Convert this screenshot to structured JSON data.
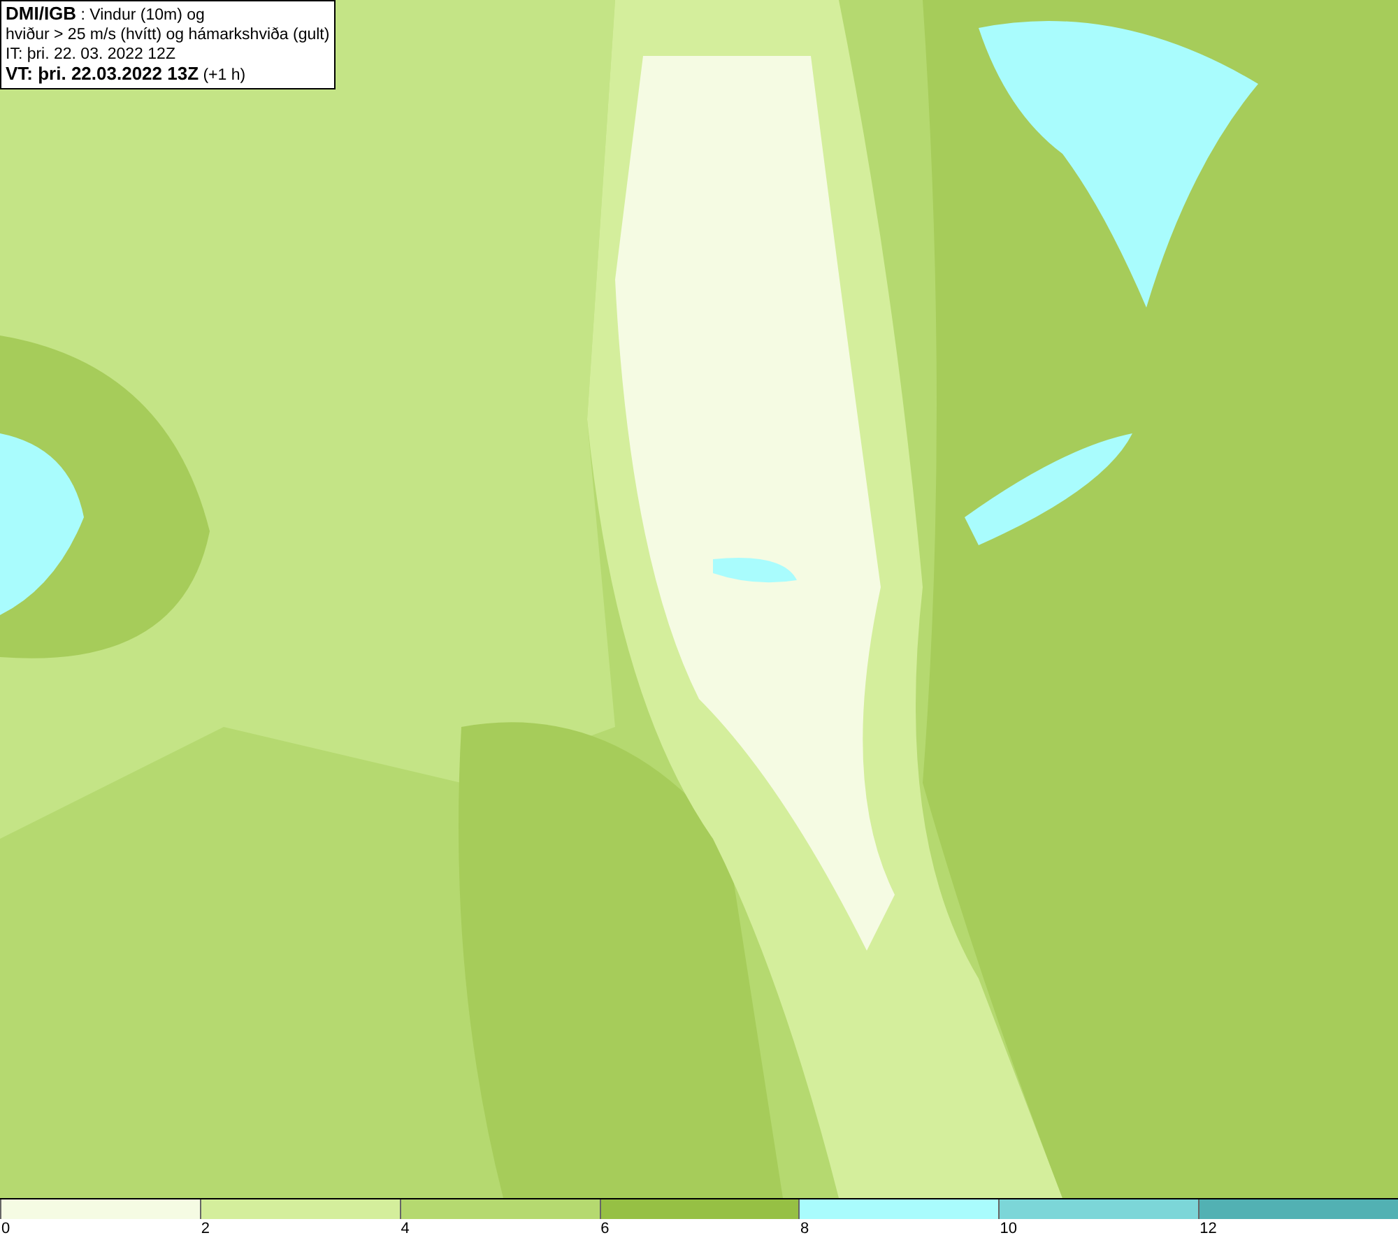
{
  "caption": [
    "**DMI/IGB** : Vindur (10m) og",
    "hviður > 25 m/s (hvítt) og hámarkshviða (gult)",
    "IT: þri. 22. 03. 2022 12Z",
    "**VT: þri. 22.03.2022 13Z** (+1 h)"
  ],
  "legend": [
    {
      "color": "#f5fbe3",
      "label": "0"
    },
    {
      "color": "#d4ee9c",
      "label": "2"
    },
    {
      "color": "#b5d970",
      "label": "4"
    },
    {
      "color": "#96c044",
      "label": "6"
    },
    {
      "color": "#a9fcfd",
      "label": "8"
    },
    {
      "color": "#7cd6d8",
      "label": "10"
    },
    {
      "color": "#52b1b3",
      "label": "12"
    }
  ]
}
